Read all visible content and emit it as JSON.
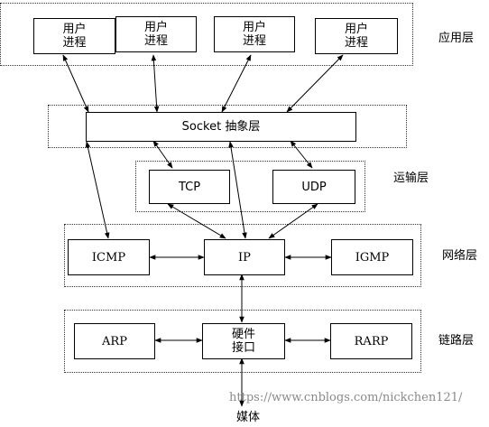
{
  "application_layer": {
    "label": "应用层",
    "processes": [
      {
        "label": "用户\n进程"
      },
      {
        "label": "用户\n进程"
      },
      {
        "label": "用户\n进程"
      },
      {
        "label": "用户\n进程"
      }
    ]
  },
  "socket_layer": {
    "label": "Socket 抽象层"
  },
  "transport_layer": {
    "label": "运输层",
    "tcp": "TCP",
    "udp": "UDP"
  },
  "network_layer": {
    "label": "网络层",
    "icmp": "ICMP",
    "ip": "IP",
    "igmp": "IGMP"
  },
  "link_layer": {
    "label": "链路层",
    "arp": "ARP",
    "hardware": "硬件\n接口",
    "rarp": "RARP"
  },
  "media": "媒体",
  "watermark": "https://www.cnblogs.com/nickchen121/"
}
